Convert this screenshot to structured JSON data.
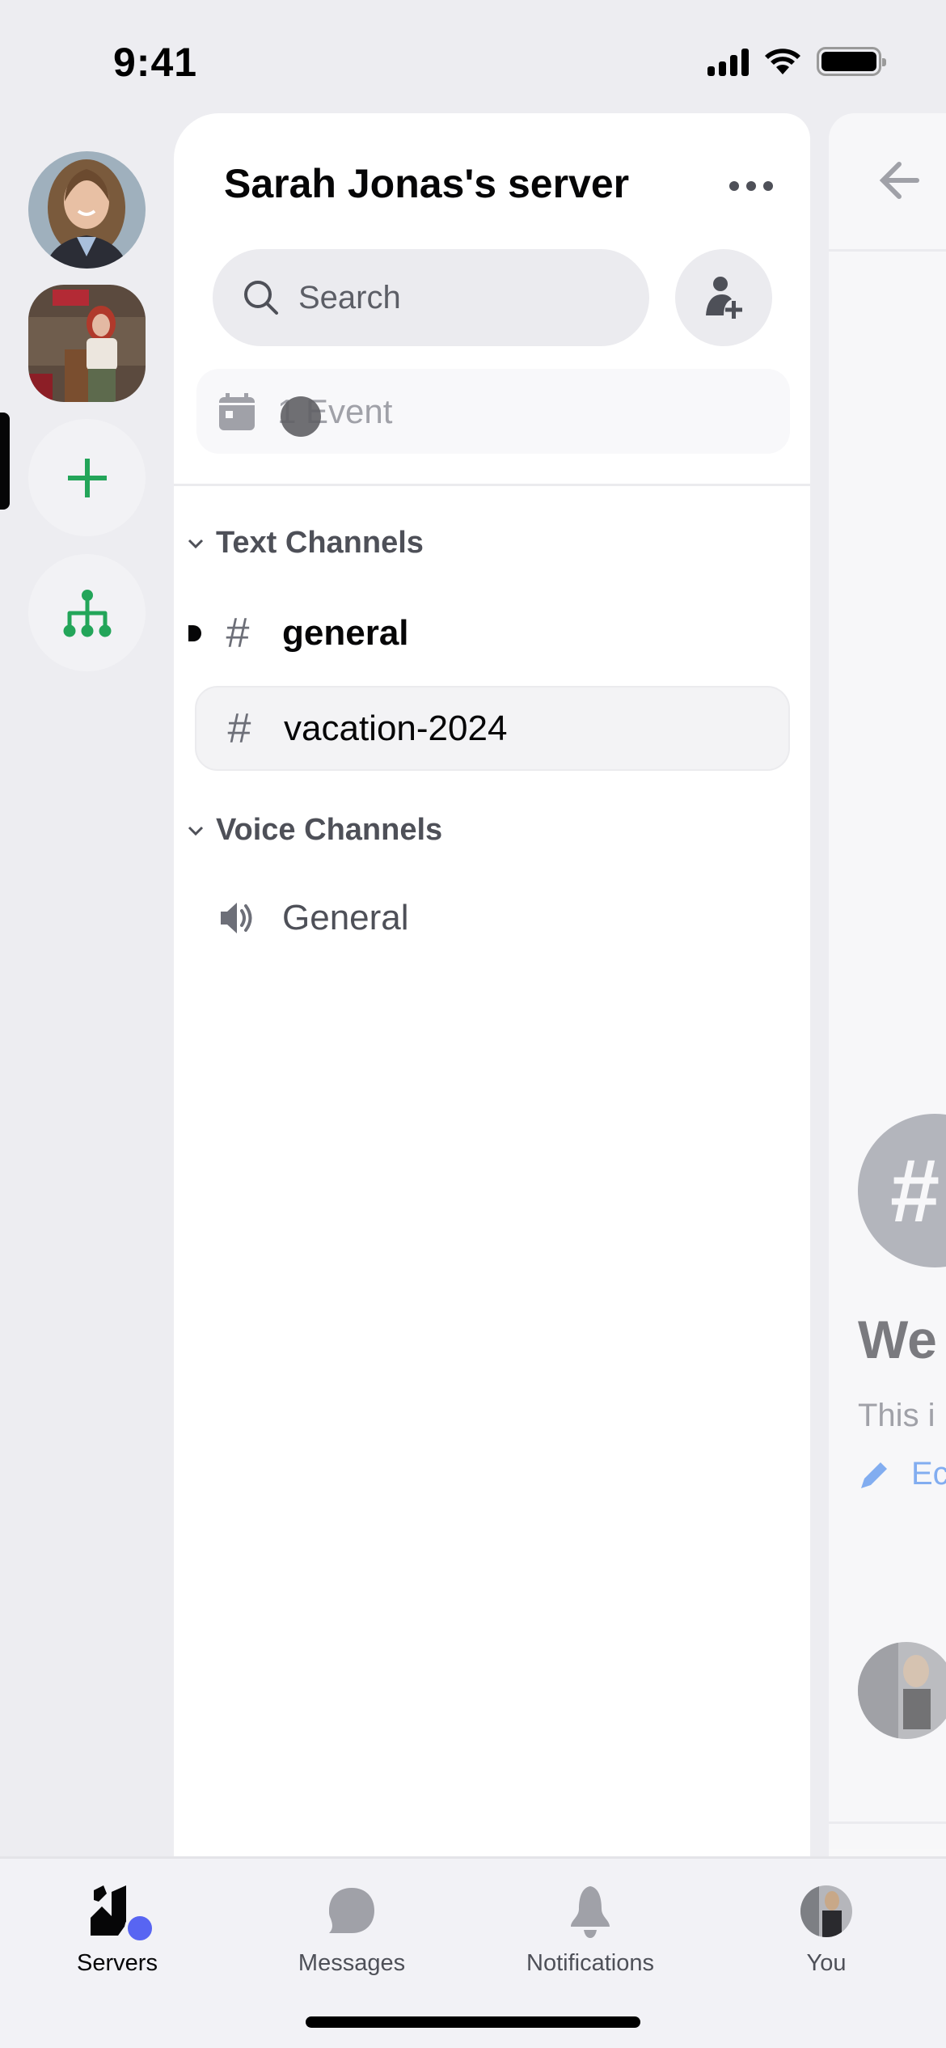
{
  "status_bar": {
    "time": "9:41",
    "icons": [
      "cellular-signal-icon",
      "wifi-icon",
      "battery-icon"
    ]
  },
  "server_rail": {
    "servers": [
      {
        "name": "Sarah Jonas avatar server",
        "shape": "circle",
        "selected": false
      },
      {
        "name": "Red-haired woman server",
        "shape": "squircle",
        "selected": true
      }
    ],
    "add_server_icon": "plus-icon",
    "discover_icon": "hub-icon",
    "accent_color": "#23a559"
  },
  "channel_panel": {
    "server_title": "Sarah Jonas's server",
    "more_icon": "more-horizontal-icon",
    "search_placeholder": "Search",
    "invite_icon": "add-person-icon",
    "events_label": "1 Event",
    "categories": [
      {
        "label": "Text Channels",
        "channels": [
          {
            "name": "general",
            "type": "text",
            "unread": true,
            "selected": false
          },
          {
            "name": "vacation-2024",
            "type": "text",
            "unread": false,
            "selected": true
          }
        ]
      },
      {
        "label": "Voice Channels",
        "channels": [
          {
            "name": "General",
            "type": "voice",
            "unread": false,
            "selected": false
          }
        ]
      }
    ]
  },
  "peek_panel": {
    "back_icon": "arrow-left-icon",
    "welcome_text": "We",
    "description_text": "This i",
    "edit_text": "Ec",
    "edit_color": "#3c84f0"
  },
  "tab_bar": {
    "tabs": [
      {
        "label": "Servers",
        "icon": "servers-icon",
        "active": true,
        "badge_color": "#5865f2"
      },
      {
        "label": "Messages",
        "icon": "chat-bubble-icon",
        "active": false
      },
      {
        "label": "Notifications",
        "icon": "bell-icon",
        "active": false
      },
      {
        "label": "You",
        "icon": "user-avatar",
        "active": false
      }
    ]
  }
}
